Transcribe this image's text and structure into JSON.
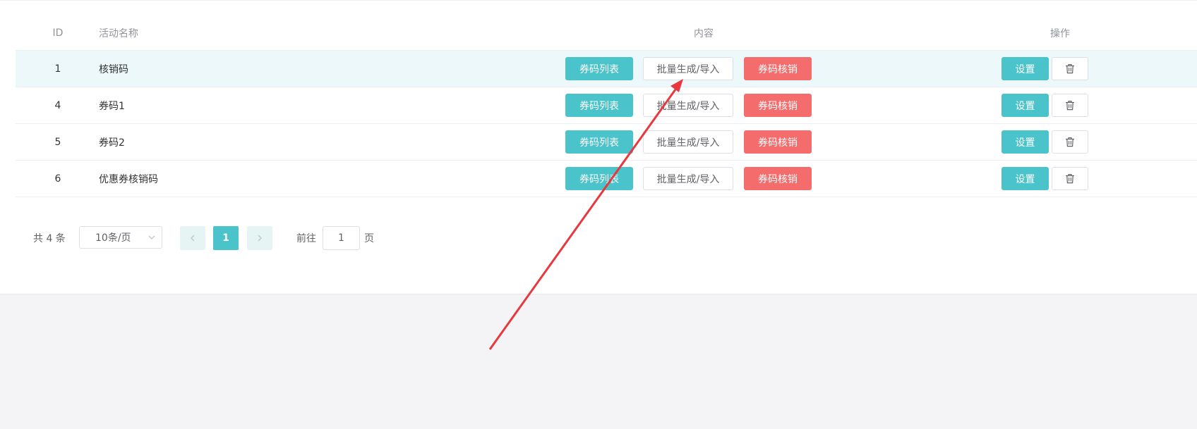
{
  "table": {
    "headers": {
      "id": "ID",
      "name": "活动名称",
      "content": "内容",
      "actions": "操作"
    },
    "rows": [
      {
        "id": "1",
        "name": "核销码"
      },
      {
        "id": "4",
        "name": "券码1"
      },
      {
        "id": "5",
        "name": "券码2"
      },
      {
        "id": "6",
        "name": "优惠券核销码"
      }
    ],
    "buttons": {
      "code_list": "券码列表",
      "batch_import": "批量生成/导入",
      "code_verify": "券码核销",
      "settings": "设置",
      "delete_icon": "trash-icon"
    }
  },
  "pagination": {
    "total": "共 4 条",
    "page_size": "10条/页",
    "current_page": "1",
    "goto_label": "前往",
    "goto_value": "1",
    "page_suffix": "页"
  },
  "colors": {
    "accent": "#4bc3ca",
    "danger": "#f56c6c",
    "row_highlight": "#ecf8f9",
    "annotation_arrow": "#e8383d"
  }
}
